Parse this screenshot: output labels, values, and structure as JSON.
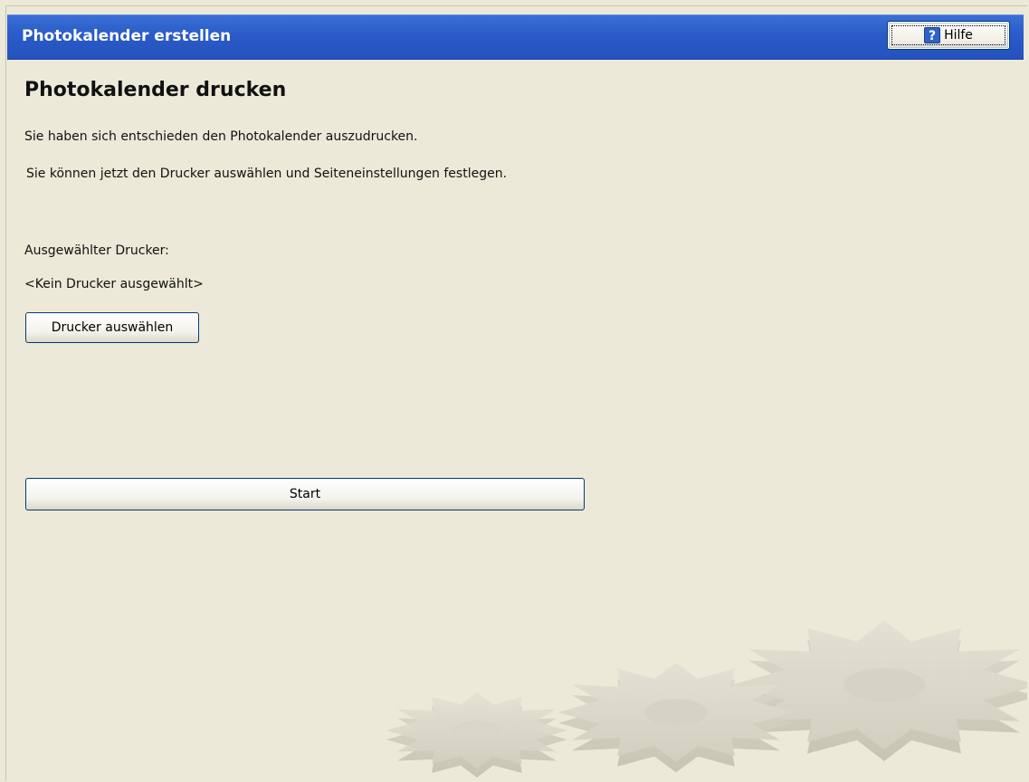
{
  "window": {
    "title": "Photokalender erstellen",
    "help_label": "Hilfe",
    "help_icon": "question-mark-icon"
  },
  "page": {
    "heading": "Photokalender drucken",
    "line1": "Sie haben sich entschieden den Photokalender auszudrucken.",
    "line2": "Sie können jetzt den Drucker auswählen und Seiteneinstellungen festlegen.",
    "printer_label": "Ausgewählter Drucker:",
    "printer_value": "<Kein Drucker ausgewählt>",
    "select_printer_button": "Drucker auswählen",
    "start_button": "Start"
  },
  "colors": {
    "background": "#ece9d8",
    "titlebar": "#2a5bc8",
    "button_border": "#003c74"
  },
  "decoration": "gears-watermark"
}
